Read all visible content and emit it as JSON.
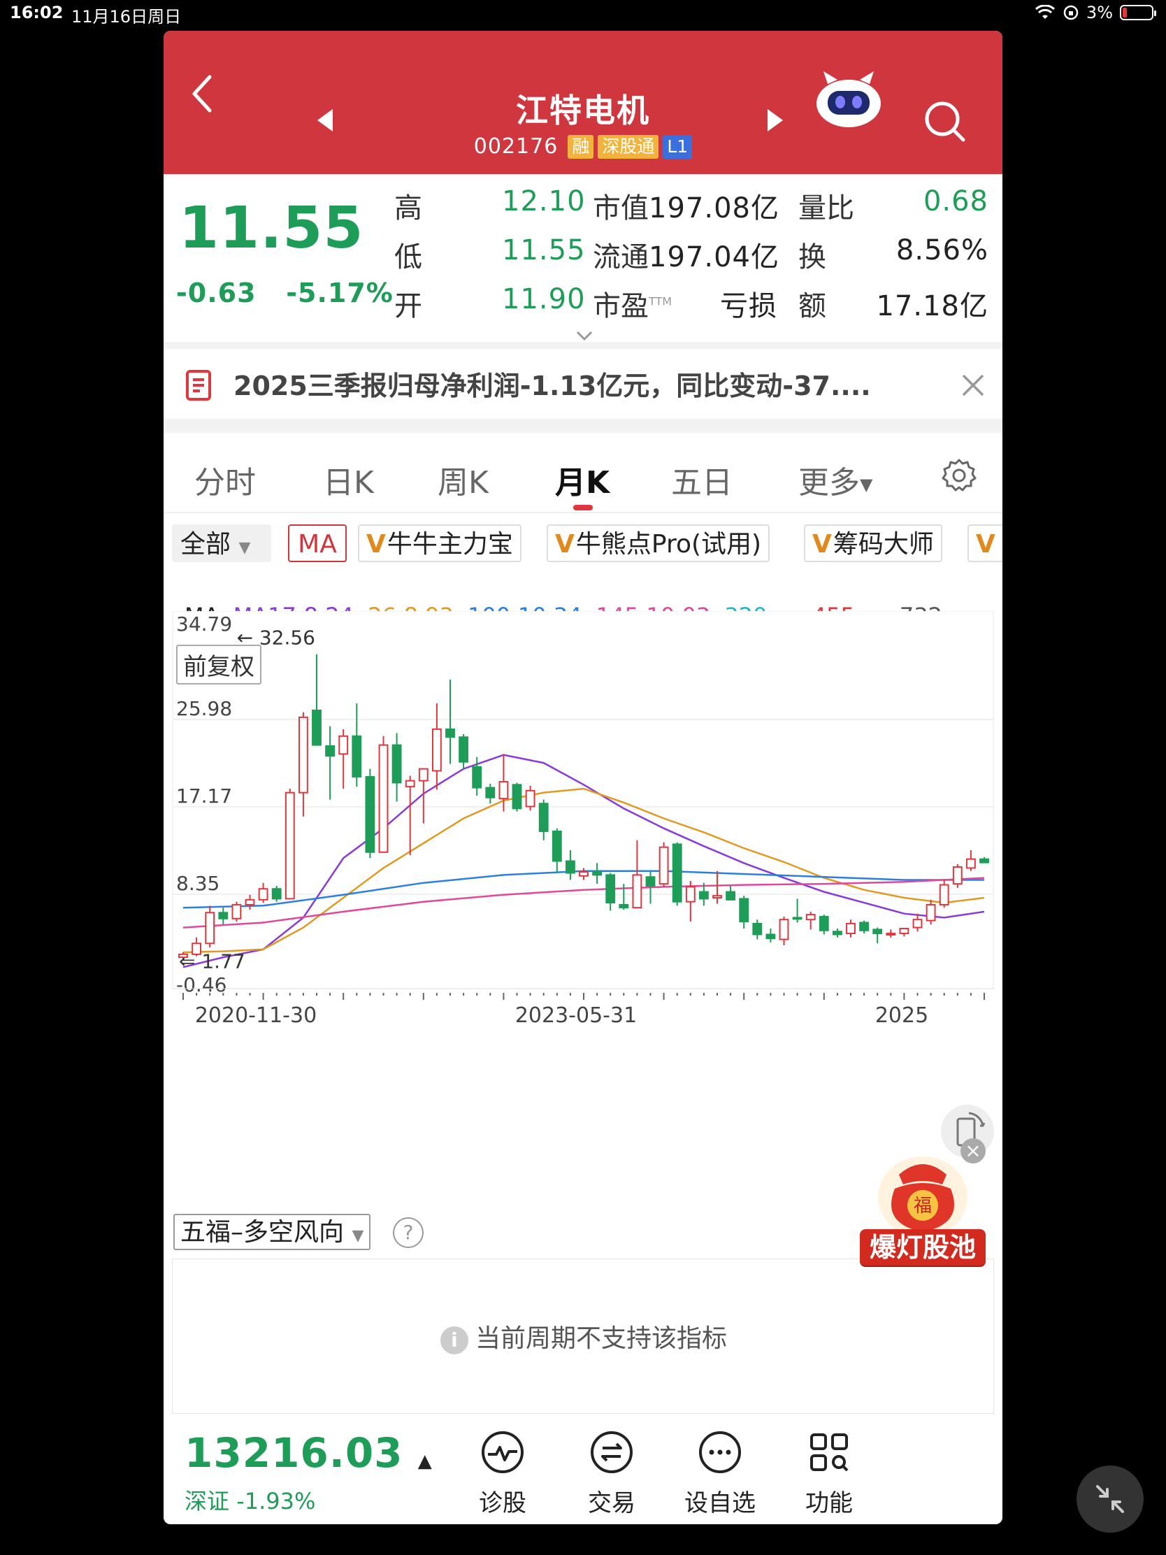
{
  "status": {
    "time": "16:02",
    "date": "11月16日周日",
    "battery": "3%"
  },
  "header": {
    "title": "江特电机",
    "code": "002176",
    "tags": [
      "融",
      "深股通",
      "L1"
    ]
  },
  "quote": {
    "price": "11.55",
    "change": "-0.63",
    "change_pct": "-5.17%",
    "rows": [
      {
        "l1": "高",
        "v1": "12.10",
        "l2": "市值",
        "v2": "197.08亿",
        "l3": "量比",
        "v3": "0.68"
      },
      {
        "l1": "低",
        "v1": "11.55",
        "l2": "流通",
        "v2": "197.04亿",
        "l3": "换",
        "v3": "8.56%"
      },
      {
        "l1": "开",
        "v1": "11.90",
        "l2": "市盈",
        "l2sup": "TTM",
        "v2": "亏损",
        "l3": "额",
        "v3": "17.18亿"
      }
    ]
  },
  "notice": {
    "text": "2025三季报归母净利润-1.13亿元，同比变动-37...."
  },
  "tabs": [
    "分时",
    "日K",
    "周K",
    "月K",
    "五日",
    "更多"
  ],
  "active_tab": "月K",
  "indicators": {
    "all": "全部",
    "ma": "MA",
    "chips": [
      "牛牛主力宝",
      "牛熊点Pro(试用)",
      "筹码大师"
    ]
  },
  "ma_legend": {
    "label": "MA",
    "items": [
      {
        "text": "MA17:8.24",
        "color": "#8a3ad6"
      },
      {
        "text": "26:8.93",
        "color": "#e09a22"
      },
      {
        "text": "100:10.34",
        "color": "#2b7fe0"
      },
      {
        "text": "145:10.03",
        "color": "#e0489c"
      },
      {
        "text": "320:- -",
        "color": "#22b8c9"
      },
      {
        "text": "455:- -",
        "color": "#e0363e"
      },
      {
        "text": "732:- -",
        "color": "#555555"
      }
    ]
  },
  "chart_data": {
    "type": "candlestick",
    "adjust_label": "前复权",
    "y_ticks": [
      "34.79",
      "25.98",
      "17.17",
      "8.35",
      "-0.46"
    ],
    "ylim": [
      -0.46,
      34.79
    ],
    "max_marker": "32.56",
    "min_marker": "1.77",
    "x_ticks": [
      "2020-11-30",
      "2023-05-31",
      "2025"
    ],
    "candles": [
      {
        "o": 2.0,
        "h": 2.5,
        "l": 1.77,
        "c": 2.3
      },
      {
        "o": 2.3,
        "h": 4.0,
        "l": 2.1,
        "c": 3.4
      },
      {
        "o": 3.4,
        "h": 7.2,
        "l": 3.0,
        "c": 6.5
      },
      {
        "o": 6.5,
        "h": 7.0,
        "l": 5.3,
        "c": 5.9
      },
      {
        "o": 5.9,
        "h": 7.6,
        "l": 5.6,
        "c": 7.3
      },
      {
        "o": 7.3,
        "h": 8.3,
        "l": 6.8,
        "c": 7.8
      },
      {
        "o": 7.8,
        "h": 9.5,
        "l": 7.5,
        "c": 8.9
      },
      {
        "o": 8.9,
        "h": 9.2,
        "l": 7.6,
        "c": 7.9
      },
      {
        "o": 7.9,
        "h": 19.0,
        "l": 7.9,
        "c": 18.6
      },
      {
        "o": 18.6,
        "h": 26.7,
        "l": 16.2,
        "c": 26.2
      },
      {
        "o": 26.9,
        "h": 32.56,
        "l": 24.0,
        "c": 23.4
      },
      {
        "o": 23.3,
        "h": 25.3,
        "l": 17.9,
        "c": 22.3
      },
      {
        "o": 22.5,
        "h": 25.0,
        "l": 19.0,
        "c": 24.3
      },
      {
        "o": 24.3,
        "h": 27.6,
        "l": 19.2,
        "c": 20.2
      },
      {
        "o": 20.2,
        "h": 21.0,
        "l": 12.0,
        "c": 12.6
      },
      {
        "o": 12.6,
        "h": 24.3,
        "l": 13.0,
        "c": 23.4
      },
      {
        "o": 23.4,
        "h": 24.6,
        "l": 17.7,
        "c": 19.6
      },
      {
        "o": 19.2,
        "h": 20.3,
        "l": 12.3,
        "c": 19.8
      },
      {
        "o": 19.8,
        "h": 21.0,
        "l": 15.5,
        "c": 21.0
      },
      {
        "o": 20.8,
        "h": 27.6,
        "l": 18.9,
        "c": 25.0
      },
      {
        "o": 25.0,
        "h": 30.0,
        "l": 21.5,
        "c": 24.2
      },
      {
        "o": 24.2,
        "h": 24.5,
        "l": 21.0,
        "c": 21.7
      },
      {
        "o": 21.2,
        "h": 22.2,
        "l": 18.3,
        "c": 19.1
      },
      {
        "o": 19.1,
        "h": 19.5,
        "l": 17.5,
        "c": 18.1
      },
      {
        "o": 18.0,
        "h": 22.5,
        "l": 16.7,
        "c": 19.7
      },
      {
        "o": 19.4,
        "h": 19.6,
        "l": 16.7,
        "c": 17.0
      },
      {
        "o": 17.2,
        "h": 19.3,
        "l": 16.8,
        "c": 18.8
      },
      {
        "o": 17.5,
        "h": 17.9,
        "l": 13.8,
        "c": 14.7
      },
      {
        "o": 14.7,
        "h": 15.0,
        "l": 10.5,
        "c": 11.7
      },
      {
        "o": 11.7,
        "h": 12.8,
        "l": 9.8,
        "c": 10.5
      },
      {
        "o": 10.2,
        "h": 11.0,
        "l": 9.8,
        "c": 10.6
      },
      {
        "o": 10.6,
        "h": 11.5,
        "l": 9.4,
        "c": 10.3
      },
      {
        "o": 10.3,
        "h": 10.5,
        "l": 6.7,
        "c": 7.5
      },
      {
        "o": 7.3,
        "h": 9.4,
        "l": 6.8,
        "c": 7.0
      },
      {
        "o": 7.0,
        "h": 13.8,
        "l": 7.0,
        "c": 10.3
      },
      {
        "o": 10.1,
        "h": 10.6,
        "l": 7.4,
        "c": 9.2
      },
      {
        "o": 9.4,
        "h": 13.6,
        "l": 9.1,
        "c": 13.1
      },
      {
        "o": 13.4,
        "h": 13.6,
        "l": 7.2,
        "c": 7.6
      },
      {
        "o": 7.6,
        "h": 9.7,
        "l": 5.6,
        "c": 9.1
      },
      {
        "o": 8.6,
        "h": 9.5,
        "l": 7.2,
        "c": 7.9
      },
      {
        "o": 8.0,
        "h": 10.7,
        "l": 7.4,
        "c": 8.2
      },
      {
        "o": 8.6,
        "h": 9.2,
        "l": 7.8,
        "c": 7.8
      },
      {
        "o": 7.9,
        "h": 8.2,
        "l": 4.9,
        "c": 5.6
      },
      {
        "o": 5.4,
        "h": 5.8,
        "l": 3.8,
        "c": 4.3
      },
      {
        "o": 4.3,
        "h": 4.9,
        "l": 3.5,
        "c": 3.9
      },
      {
        "o": 3.8,
        "h": 6.1,
        "l": 3.2,
        "c": 5.8
      },
      {
        "o": 6.0,
        "h": 7.9,
        "l": 5.5,
        "c": 5.9
      },
      {
        "o": 5.8,
        "h": 6.6,
        "l": 4.8,
        "c": 6.3
      },
      {
        "o": 6.1,
        "h": 6.3,
        "l": 4.3,
        "c": 4.7
      },
      {
        "o": 4.6,
        "h": 4.9,
        "l": 4.0,
        "c": 4.3
      },
      {
        "o": 4.4,
        "h": 5.8,
        "l": 4.0,
        "c": 5.4
      },
      {
        "o": 5.5,
        "h": 5.7,
        "l": 4.4,
        "c": 4.7
      },
      {
        "o": 4.8,
        "h": 5.0,
        "l": 3.4,
        "c": 4.4
      },
      {
        "o": 4.3,
        "h": 4.8,
        "l": 4.0,
        "c": 4.4
      },
      {
        "o": 4.4,
        "h": 4.9,
        "l": 4.1,
        "c": 4.9
      },
      {
        "o": 5.0,
        "h": 6.4,
        "l": 4.6,
        "c": 5.8
      },
      {
        "o": 5.7,
        "h": 7.8,
        "l": 5.3,
        "c": 7.3
      },
      {
        "o": 7.3,
        "h": 9.8,
        "l": 7.0,
        "c": 9.3
      },
      {
        "o": 9.4,
        "h": 11.4,
        "l": 9.0,
        "c": 11.1
      },
      {
        "o": 11.0,
        "h": 12.8,
        "l": 10.7,
        "c": 11.9
      },
      {
        "o": 11.9,
        "h": 12.1,
        "l": 11.55,
        "c": 11.55
      }
    ],
    "ma_lines": [
      {
        "name": "MA17",
        "color": "#8a3ad6",
        "values": [
          [
            0,
            1.0
          ],
          [
            3,
            2.0
          ],
          [
            6,
            2.8
          ],
          [
            9,
            6.0
          ],
          [
            12,
            12.0
          ],
          [
            15,
            15.0
          ],
          [
            18,
            18.5
          ],
          [
            21,
            21.0
          ],
          [
            24,
            22.4
          ],
          [
            27,
            21.6
          ],
          [
            30,
            19.4
          ],
          [
            33,
            17.0
          ],
          [
            36,
            15.0
          ],
          [
            39,
            13.2
          ],
          [
            42,
            11.5
          ],
          [
            45,
            10.0
          ],
          [
            48,
            8.6
          ],
          [
            51,
            7.5
          ],
          [
            54,
            6.4
          ],
          [
            57,
            6.0
          ],
          [
            60,
            6.6
          ]
        ]
      },
      {
        "name": "26",
        "color": "#e09a22",
        "values": [
          [
            0,
            2.5
          ],
          [
            3,
            2.6
          ],
          [
            6,
            2.8
          ],
          [
            9,
            5.0
          ],
          [
            12,
            8.0
          ],
          [
            15,
            11.0
          ],
          [
            18,
            13.5
          ],
          [
            21,
            16.0
          ],
          [
            24,
            17.8
          ],
          [
            27,
            18.6
          ],
          [
            30,
            19.0
          ],
          [
            33,
            17.6
          ],
          [
            36,
            16.0
          ],
          [
            39,
            14.6
          ],
          [
            42,
            13.0
          ],
          [
            45,
            11.6
          ],
          [
            48,
            10.0
          ],
          [
            51,
            8.8
          ],
          [
            54,
            8.0
          ],
          [
            57,
            7.5
          ],
          [
            60,
            8.0
          ]
        ]
      },
      {
        "name": "100",
        "color": "#2b7fe0",
        "values": [
          [
            0,
            7.0
          ],
          [
            6,
            7.2
          ],
          [
            12,
            8.3
          ],
          [
            18,
            9.5
          ],
          [
            24,
            10.3
          ],
          [
            30,
            10.7
          ],
          [
            36,
            10.7
          ],
          [
            42,
            10.4
          ],
          [
            48,
            10.1
          ],
          [
            54,
            9.8
          ],
          [
            60,
            9.8
          ]
        ]
      },
      {
        "name": "145",
        "color": "#e0489c",
        "values": [
          [
            0,
            5.0
          ],
          [
            6,
            5.5
          ],
          [
            12,
            6.6
          ],
          [
            18,
            7.6
          ],
          [
            24,
            8.3
          ],
          [
            30,
            8.8
          ],
          [
            36,
            9.1
          ],
          [
            42,
            9.3
          ],
          [
            48,
            9.4
          ],
          [
            54,
            9.6
          ],
          [
            60,
            10.0
          ]
        ]
      }
    ]
  },
  "sub_indicator": {
    "name": "五福–多空风向",
    "help": "?",
    "message": "当前周期不支持该指标",
    "info_icon": "i"
  },
  "promo": {
    "label": "爆灯股池",
    "badge": "福"
  },
  "bottom_bar": {
    "index_value": "13216.03",
    "index_name": "深证",
    "index_pct": "-1.93%",
    "nav": [
      {
        "label": "诊股",
        "icon": "pulse-icon"
      },
      {
        "label": "交易",
        "icon": "exchange-icon"
      },
      {
        "label": "设自选",
        "icon": "more-dots-icon"
      },
      {
        "label": "功能",
        "icon": "grid-icon"
      }
    ]
  },
  "colors": {
    "brand_red": "#d0363e",
    "up": "#e0363e",
    "down": "#1e9d58"
  }
}
